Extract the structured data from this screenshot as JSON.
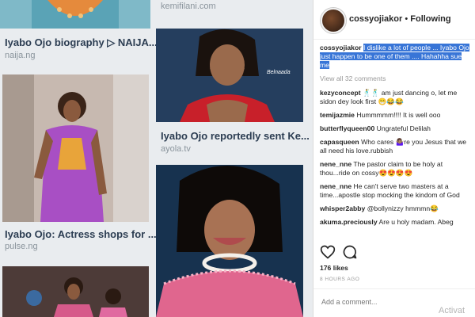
{
  "grid": {
    "col1": [
      {
        "caption": "Iyabo Ojo biography ▷ NAIJA...",
        "source": "naija.ng"
      },
      {
        "caption": "Iyabo Ojo: Actress shops for ...",
        "source": "pulse.ng"
      }
    ],
    "col2": [
      {
        "top_source": "kemifilani.com"
      },
      {
        "caption": "Iyabo Ojo reportedly sent Ke...",
        "source": "ayola.tv",
        "watermark": "Belnaada"
      }
    ]
  },
  "instagram": {
    "username": "cossyojiakor",
    "separator": "•",
    "follow_status": "Following",
    "caption_user": "cossyojiakor",
    "caption_text": "I dislike a lot of people ... Iyabo Ojo just happen to be one of them .... Hahahha sue me",
    "view_all": "View all 32 comments",
    "comments": [
      {
        "user": "kezyconcept",
        "text": "🕺🕺 am just dancing o, let me sidon dey look first 😁😂😂"
      },
      {
        "user": "temijazmie",
        "text": "Hummmmm!!!! It is well ooo"
      },
      {
        "user": "butterflyqueen00",
        "text": "Ungrateful Delilah"
      },
      {
        "user": "capasqueen",
        "text": "Who cares 🤷🏽‍♀️re you Jesus that we all need his love.rubbish"
      },
      {
        "user": "nene_nne",
        "text": "The pastor claim to be holy at thou...ride on cossy😍😍😍😍"
      },
      {
        "user": "nene_nne",
        "text": "He can't serve two masters at a time...apostle stop mocking the kindom of God"
      },
      {
        "user": "whisper2abby",
        "text": "@bollynizzy hmmmn😂"
      },
      {
        "user": "akuma.preciously",
        "text": "Are u holy madam. Abeg"
      }
    ],
    "likes": "176 likes",
    "time": "8 HOURS AGO",
    "add_comment_placeholder": "Add a comment...",
    "watermark": "Activat",
    "colors": {
      "highlight": "#3875d7",
      "username": "#262626",
      "muted": "#999999"
    }
  }
}
